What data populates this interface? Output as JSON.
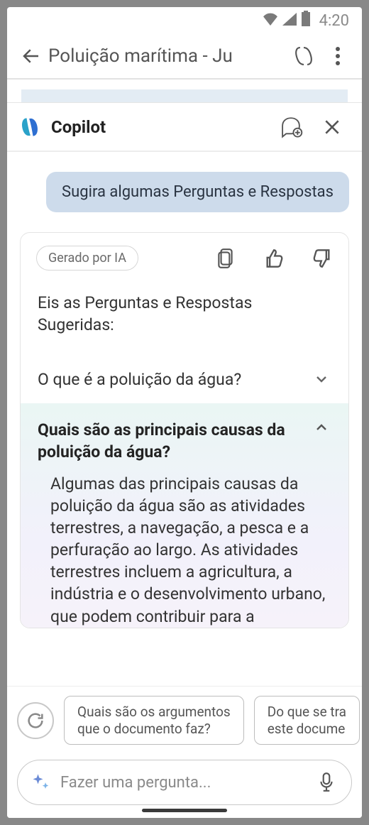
{
  "statusbar": {
    "time": "4:20"
  },
  "app_header": {
    "title": "Poluição marítima - Ju"
  },
  "copilot_header": {
    "title": "Copilot"
  },
  "chat": {
    "user_message": "Sugira algumas Perguntas e Respostas",
    "ai_chip": "Gerado por IA",
    "ai_intro": "Eis as Perguntas e Respostas Sugeridas:",
    "qa_collapsed": {
      "question": "O que é a poluição da água?"
    },
    "qa_expanded": {
      "question": "Quais são as principais causas da poluição da água?",
      "answer": "Algumas das principais causas da poluição da água são as atividades terrestres, a navegação, a pesca e a perfuração ao largo. As atividades terrestres incluem a agricultura, a indústria e o desenvolvimento urbano, que podem contribuir para a"
    }
  },
  "suggestions": {
    "s1_line1": "Quais são os argumentos",
    "s1_line2": "que o documento faz?",
    "s2_line1": "Do que se tra",
    "s2_line2": "este docume"
  },
  "input": {
    "placeholder": "Fazer uma pergunta..."
  }
}
